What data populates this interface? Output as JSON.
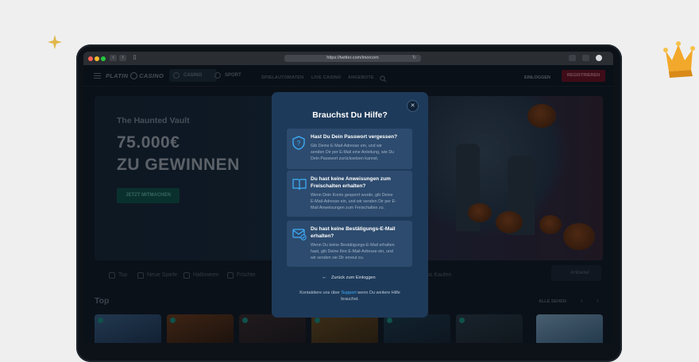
{
  "browser": {
    "url": "https://twitter.com/imorcom"
  },
  "site": {
    "logo_left": "PLATIN",
    "logo_right": "CASINO",
    "tabs": [
      "CASINO",
      "SPORT"
    ],
    "links": [
      "SPIELAUTOMATEN",
      "LIVE CASINO",
      "ANGEBOTE"
    ],
    "login": "EINLOGGEN",
    "register": "REGISTRIEREN"
  },
  "hero": {
    "subtitle": "The Haunted Vault",
    "amount": "75.000€",
    "headline": "ZU GEWINNEN",
    "cta": "JETZT MITMACHEN"
  },
  "categories": [
    "Top",
    "Neue Spiele",
    "Halloween",
    "Früchte",
    "us Kaufen"
  ],
  "provider_label": "Anbieter",
  "section": {
    "title": "Top",
    "see_all": "ALLE SEHEN"
  },
  "modal": {
    "title": "Brauchst Du Hilfe?",
    "close_icon": "close-icon",
    "cards": [
      {
        "icon": "shield-question-icon",
        "title": "Hast Du Dein Passwort vergessen?",
        "lines": [
          "Gib Deine E-Mail-Adresse ein, und wir",
          "senden Dir per E-Mail eine Anleitung, wie Du",
          "Dein Passwort zurücksetzen kannst."
        ]
      },
      {
        "icon": "book-icon",
        "title": "Du hast keine Anweisungen zum Freischalten erhalten?",
        "lines": [
          "Wenn Dein Konto gesperrt wurde, gib Deine",
          "E-Mail-Adresse ein, und wir senden Dir per E-",
          "Mail Anweisungen zum Freischalten zu."
        ]
      },
      {
        "icon": "mail-check-icon",
        "title": "Du hast keine Bestätigungs-E-Mail erhalten?",
        "lines": [
          "Wenn Du keine Bestätigungs-E-Mail erhalten",
          "hast, gib Deine Ihre E-Mail-Adresse ein, und",
          "wir senden sie Dir erneut zu."
        ]
      }
    ],
    "back_link": "Zurück zum Einloggen",
    "footer_before": "Kontaktiere uns über",
    "footer_link": "Support",
    "footer_after": "wenn Du weitere Hilfe",
    "footer_line2": "brauchst."
  }
}
